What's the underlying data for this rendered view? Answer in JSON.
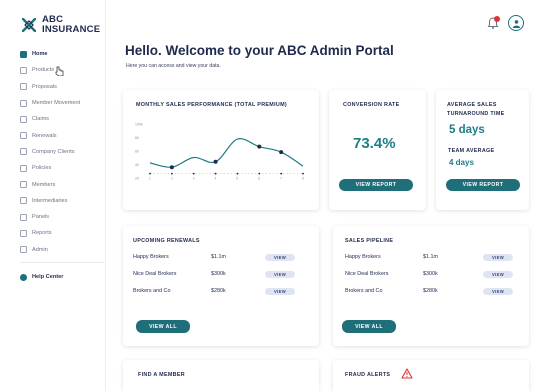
{
  "brand": {
    "line1": "ABC",
    "line2": "INSURANCE"
  },
  "sidebar": {
    "items": [
      {
        "label": "Home",
        "icon": "home-icon"
      },
      {
        "label": "Products",
        "icon": "box-icon"
      },
      {
        "label": "Proposals",
        "icon": "document-icon"
      },
      {
        "label": "Member Movement",
        "icon": "people-icon"
      },
      {
        "label": "Claims",
        "icon": "claims-icon"
      },
      {
        "label": "Renewals",
        "icon": "refresh-icon"
      },
      {
        "label": "Company Clients",
        "icon": "building-icon"
      },
      {
        "label": "Policies",
        "icon": "policy-icon"
      },
      {
        "label": "Members",
        "icon": "member-icon"
      },
      {
        "label": "Intermediaries",
        "icon": "network-icon"
      },
      {
        "label": "Panels",
        "icon": "panel-icon"
      },
      {
        "label": "Reports",
        "icon": "report-icon"
      },
      {
        "label": "Admin",
        "icon": "admin-icon"
      }
    ],
    "help": {
      "label": "Help Center",
      "icon": "help-icon"
    }
  },
  "header": {
    "title": "Hello. Welcome to your ABC Admin Portal",
    "subtitle": "Here you can access and view your data."
  },
  "sales_card": {
    "title": "MONTHLY SALES PERFORMANCE (TOTAL PREMIUM)"
  },
  "conversion_card": {
    "title": "CONVERSION RATE",
    "value": "73.4%",
    "button": "VIEW REPORT"
  },
  "turnaround_card": {
    "title_line1": "AVERAGE SALES",
    "title_line2": "TURNAROUND TIME",
    "value": "5 days",
    "team_label": "TEAM AVERAGE",
    "team_value": "4 days",
    "button": "VIEW REPORT"
  },
  "renewals_card": {
    "title": "UPCOMING RENEWALS",
    "rows": [
      {
        "name": "Happy Brokers",
        "amount": "$1.1m",
        "action": "VIEW"
      },
      {
        "name": "Nice Deal Brokers",
        "amount": "$300k",
        "action": "VIEW"
      },
      {
        "name": "Brokers and Co",
        "amount": "$280k",
        "action": "VIEW"
      }
    ],
    "button": "VIEW ALL"
  },
  "pipeline_card": {
    "title": "SALES PIPELINE",
    "rows": [
      {
        "name": "Happy Brokers",
        "amount": "$1.1m",
        "action": "VIEW"
      },
      {
        "name": "Nice Deal Brokers",
        "amount": "$300k",
        "action": "VIEW"
      },
      {
        "name": "Brokers and Co",
        "amount": "$280k",
        "action": "VIEW"
      }
    ],
    "button": "VIEW ALL"
  },
  "member_card": {
    "title": "FIND A MEMBER"
  },
  "fraud_card": {
    "title": "FRAUD ALERTS"
  },
  "colors": {
    "accent": "#1e6f7a",
    "navy": "#1f2a4d",
    "alert": "#e03131"
  },
  "chart_data": {
    "type": "line",
    "title": "MONTHLY SALES PERFORMANCE (TOTAL PREMIUM)",
    "x": [
      1,
      2,
      3,
      4,
      5,
      6,
      7,
      8
    ],
    "y_ticks": [
      "100k",
      "80",
      "60",
      "40",
      "20"
    ],
    "ylim": [
      0,
      100
    ],
    "series": [
      {
        "values": [
          28,
          20,
          38,
          30,
          72,
          58,
          48,
          22
        ],
        "markers": [
          false,
          true,
          false,
          true,
          false,
          true,
          true,
          false
        ]
      }
    ],
    "baseline": 8
  }
}
